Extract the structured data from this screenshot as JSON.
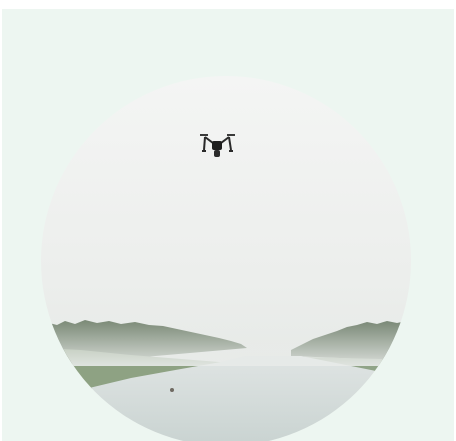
{
  "panel": {
    "background": "#edf6f1"
  },
  "photo": {
    "subject_icon": "drone-icon",
    "colors": {
      "sky_top": "#f2f3f2",
      "sky_bottom": "#e3e6e3",
      "treeline": "#55684f",
      "grass": "#8fa585",
      "water": "#cfd8d6"
    }
  }
}
